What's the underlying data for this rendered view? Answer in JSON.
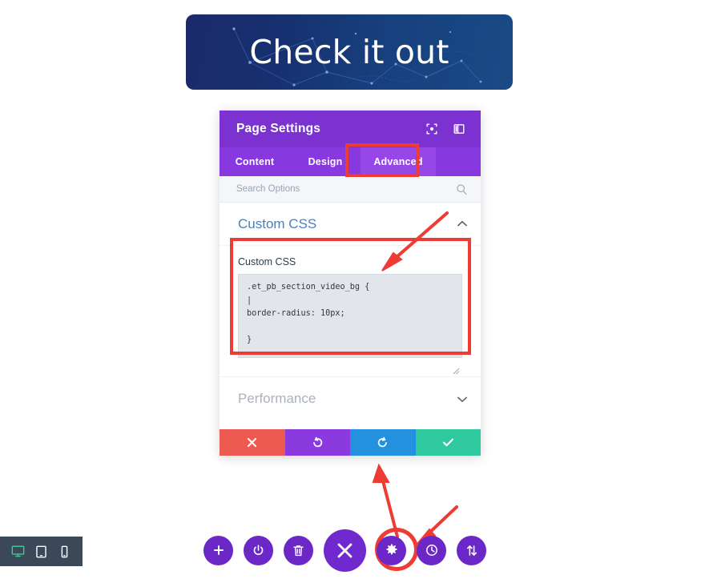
{
  "hero": {
    "title": "Check it out",
    "bg_left": "#1b2a6b",
    "bg_right": "#1a4a85"
  },
  "panel": {
    "title": "Page Settings",
    "header_color": "#7B32D1",
    "icons": [
      {
        "name": "fullscreen-icon"
      },
      {
        "name": "layout-panel-icon"
      }
    ],
    "tabs": [
      {
        "label": "Content",
        "active": false
      },
      {
        "label": "Design",
        "active": false
      },
      {
        "label": "Advanced",
        "active": true
      }
    ],
    "search": {
      "placeholder": "Search Options",
      "value": "",
      "icon": "search-icon"
    },
    "sections": [
      {
        "key": "custom_css",
        "label": "Custom CSS",
        "expanded": true,
        "chevron": "chevron-up-icon"
      },
      {
        "key": "performance",
        "label": "Performance",
        "expanded": false,
        "chevron": "chevron-down-icon"
      }
    ],
    "css_field": {
      "label": "Custom CSS",
      "value": ".et_pb_section_video_bg {\n|\nborder-radius: 10px;\n\n}"
    },
    "footer_buttons": [
      {
        "name": "cancel-button",
        "glyph": "✖",
        "color": "#EC5A52"
      },
      {
        "name": "undo-button",
        "glyph": "↺",
        "color": "#8B3AE0"
      },
      {
        "name": "redo-button",
        "glyph": "↻",
        "color": "#2391DE"
      },
      {
        "name": "save-button",
        "glyph": "✓",
        "color": "#2FC9A0"
      }
    ]
  },
  "annotations": {
    "highlight_color": "#EE3B33",
    "targets": [
      "advanced-tab",
      "custom-css-box",
      "gear-button"
    ]
  },
  "toolbar": {
    "buttons": [
      {
        "name": "add-button",
        "glyph": "+",
        "size": "small"
      },
      {
        "name": "power-button",
        "glyph": "⏻",
        "size": "small"
      },
      {
        "name": "trash-button",
        "glyph": "🗑",
        "size": "small"
      },
      {
        "name": "close-button",
        "glyph": "✕",
        "size": "large"
      },
      {
        "name": "settings-gear-button",
        "glyph": "⚙",
        "size": "small"
      },
      {
        "name": "history-clock-button",
        "glyph": "◔",
        "size": "small"
      },
      {
        "name": "sort-arrows-button",
        "glyph": "⇅",
        "size": "small"
      }
    ]
  },
  "device_bar": {
    "buttons": [
      {
        "name": "desktop-preview-button",
        "active": true,
        "color": "#46C792"
      },
      {
        "name": "tablet-preview-button",
        "active": false,
        "color": "#ffffff"
      },
      {
        "name": "mobile-preview-button",
        "active": false,
        "color": "#ffffff"
      }
    ]
  }
}
